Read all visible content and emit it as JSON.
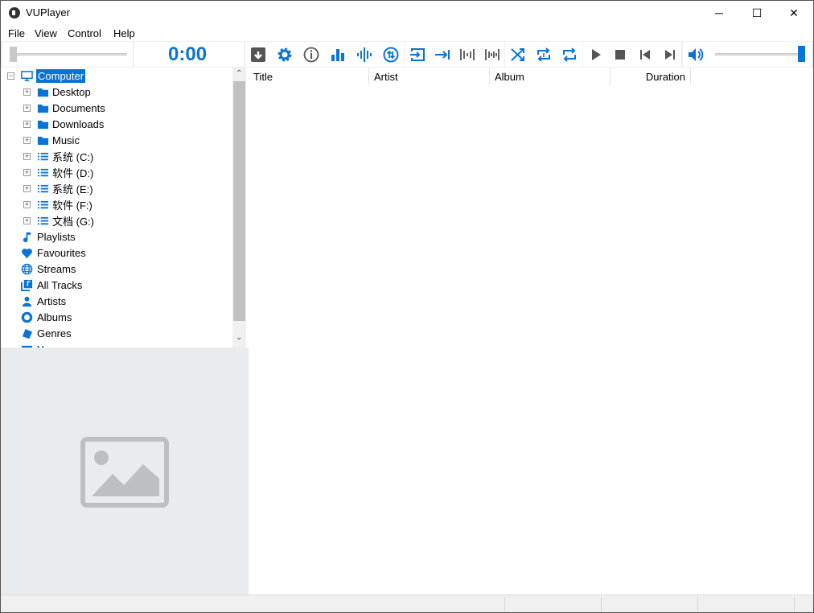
{
  "window": {
    "title": "VUPlayer",
    "minimize": "─",
    "maximize": "☐",
    "close": "✕"
  },
  "menu": [
    "File",
    "View",
    "Control",
    "Help"
  ],
  "toolbar": {
    "time": "0:00",
    "seek_position": 0,
    "volume": 1.0
  },
  "tree": {
    "root": "Computer",
    "folders": [
      {
        "label": "Desktop",
        "type": "folder"
      },
      {
        "label": "Documents",
        "type": "folder"
      },
      {
        "label": "Downloads",
        "type": "folder"
      },
      {
        "label": "Music",
        "type": "folder"
      },
      {
        "label": "系统 (C:)",
        "type": "drive"
      },
      {
        "label": "软件 (D:)",
        "type": "drive"
      },
      {
        "label": "系统 (E:)",
        "type": "drive"
      },
      {
        "label": "软件 (F:)",
        "type": "drive"
      },
      {
        "label": "文档 (G:)",
        "type": "drive"
      }
    ],
    "library": [
      {
        "label": "Playlists",
        "icon": "music-note"
      },
      {
        "label": "Favourites",
        "icon": "heart"
      },
      {
        "label": "Streams",
        "icon": "globe"
      },
      {
        "label": "All Tracks",
        "icon": "tracks"
      },
      {
        "label": "Artists",
        "icon": "person"
      },
      {
        "label": "Albums",
        "icon": "disc"
      },
      {
        "label": "Genres",
        "icon": "genres"
      },
      {
        "label": "Years",
        "icon": "calendar"
      }
    ]
  },
  "columns": [
    "Title",
    "Artist",
    "Album",
    "Duration"
  ],
  "colors": {
    "accent": "#0a74d4"
  }
}
